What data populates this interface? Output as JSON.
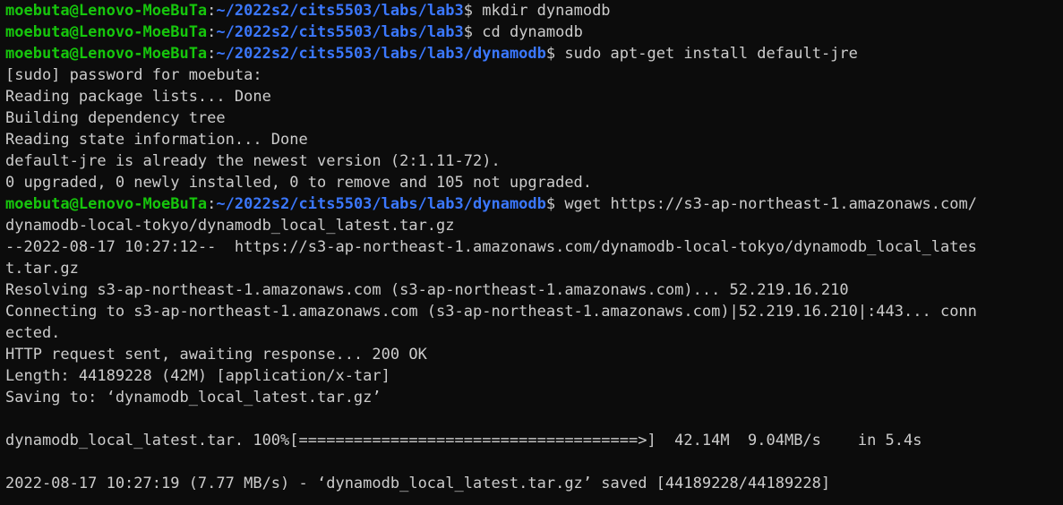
{
  "colors": {
    "background": "#0c0c0c",
    "text": "#cccccc",
    "prompt_user": "#16c60c",
    "prompt_path": "#3b78ff"
  },
  "prompts": [
    {
      "user": "moebuta@Lenovo-MoeBuTa",
      "sep": ":",
      "path": "~/2022s2/cits5503/labs/lab3",
      "dollar": "$",
      "cmd": " mkdir dynamodb"
    },
    {
      "user": "moebuta@Lenovo-MoeBuTa",
      "sep": ":",
      "path": "~/2022s2/cits5503/labs/lab3",
      "dollar": "$",
      "cmd": " cd dynamodb"
    },
    {
      "user": "moebuta@Lenovo-MoeBuTa",
      "sep": ":",
      "path": "~/2022s2/cits5503/labs/lab3/dynamodb",
      "dollar": "$",
      "cmd": " sudo apt-get install default-jre"
    },
    {
      "user": "moebuta@Lenovo-MoeBuTa",
      "sep": ":",
      "path": "~/2022s2/cits5503/labs/lab3/dynamodb",
      "dollar": "$",
      "cmd": " wget https://s3-ap-northeast-1.amazonaws.com/"
    }
  ],
  "output": {
    "apt": [
      "[sudo] password for moebuta:",
      "Reading package lists... Done",
      "Building dependency tree",
      "Reading state information... Done",
      "default-jre is already the newest version (2:1.11-72).",
      "0 upgraded, 0 newly installed, 0 to remove and 105 not upgraded."
    ],
    "wget": [
      "dynamodb-local-tokyo/dynamodb_local_latest.tar.gz",
      "--2022-08-17 10:27:12--  https://s3-ap-northeast-1.amazonaws.com/dynamodb-local-tokyo/dynamodb_local_lates",
      "t.tar.gz",
      "Resolving s3-ap-northeast-1.amazonaws.com (s3-ap-northeast-1.amazonaws.com)... 52.219.16.210",
      "Connecting to s3-ap-northeast-1.amazonaws.com (s3-ap-northeast-1.amazonaws.com)|52.219.16.210|:443... conn",
      "ected.",
      "HTTP request sent, awaiting response... 200 OK",
      "Length: 44189228 (42M) [application/x-tar]",
      "Saving to: ‘dynamodb_local_latest.tar.gz’",
      "",
      "dynamodb_local_latest.tar. 100%[=====================================>]  42.14M  9.04MB/s    in 5.4s",
      "",
      "2022-08-17 10:27:19 (7.77 MB/s) - ‘dynamodb_local_latest.tar.gz’ saved [44189228/44189228]"
    ]
  }
}
